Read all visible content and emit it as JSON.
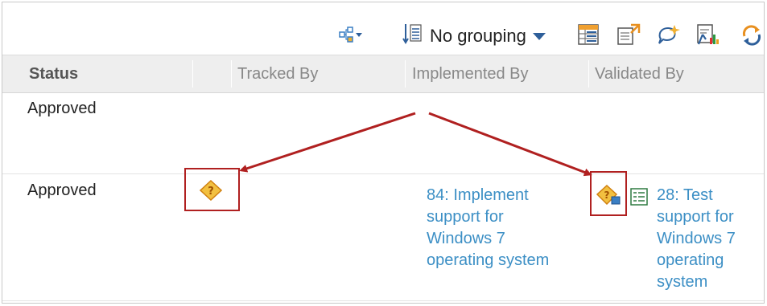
{
  "toolbar": {
    "grouping_label": "No grouping",
    "icons": [
      "hierarchy-icon",
      "sort-list-icon",
      "table-view-icon",
      "export-icon",
      "comment-icon",
      "report-icon",
      "sync-icon"
    ]
  },
  "table": {
    "columns": [
      "Status",
      "Tracked By",
      "Implemented By",
      "Validated By"
    ],
    "rows": [
      {
        "status": "Approved",
        "tracked_by": "",
        "implemented_by": "",
        "validated_by": ""
      },
      {
        "status": "Approved",
        "tracked_by_icon": "unknown-link-icon",
        "implemented_by": "84: Implement\nsupport for\nWindows 7\noperating system",
        "validated_by_icon": "unknown-link-remote-icon",
        "validated_by_type_icon": "test-case-icon",
        "validated_by": "28: Test\nsupport for\nWindows 7\noperating\nsystem"
      }
    ]
  },
  "annotation": {
    "arrow_color": "#b02020",
    "highlight_color": "#b02020"
  },
  "colors": {
    "link": "#3c8fc5",
    "header_bg": "#eeeeee"
  }
}
